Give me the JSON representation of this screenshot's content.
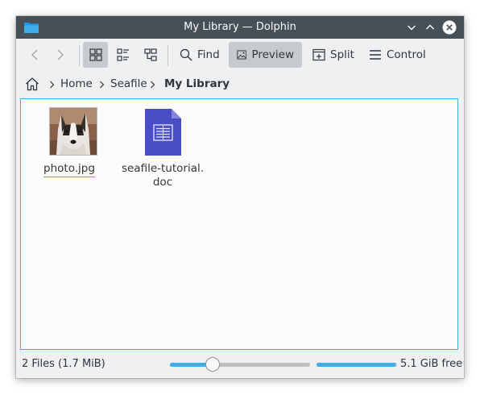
{
  "window": {
    "title": "My Library — Dolphin"
  },
  "toolbar": {
    "back_icon": "chevron-left-icon",
    "forward_icon": "chevron-right-icon",
    "view_modes": [
      "icons-view",
      "compact-view",
      "details-view"
    ],
    "find_label": "Find",
    "preview_label": "Preview",
    "split_label": "Split",
    "control_label": "Control"
  },
  "breadcrumb": {
    "home_icon": "home-icon",
    "items": [
      "Home",
      "Seafile",
      "My Library"
    ]
  },
  "files": [
    {
      "name": "photo.jpg",
      "type": "image"
    },
    {
      "name_line1": "seafile-tutorial.",
      "name_line2": "doc",
      "type": "document"
    }
  ],
  "status": {
    "summary": "2 Files (1.7 MiB)",
    "zoom_level": 0.28,
    "free_space_label": "5.1 GiB free",
    "space_used_fraction": 0.98
  },
  "colors": {
    "accent": "#3daee9",
    "titlebar": "#475057",
    "doc_icon": "#4a4ec5"
  }
}
